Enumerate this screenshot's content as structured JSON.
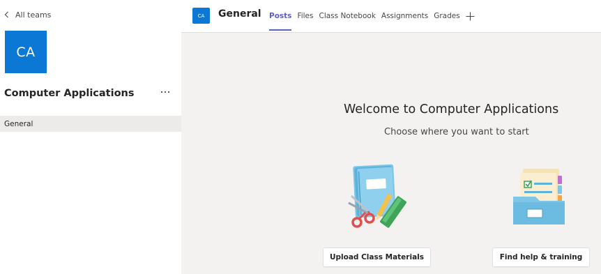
{
  "sidebar": {
    "back_label": "All teams",
    "team_avatar_initials": "CA",
    "team_name": "Computer Applications",
    "channels": [
      {
        "label": "General",
        "selected": true
      }
    ]
  },
  "header": {
    "channel_avatar_initials": "CA",
    "channel_name": "General",
    "tabs": [
      {
        "label": "Posts",
        "active": true
      },
      {
        "label": "Files",
        "active": false
      },
      {
        "label": "Class Notebook",
        "active": false
      },
      {
        "label": "Assignments",
        "active": false
      },
      {
        "label": "Grades",
        "active": false
      }
    ],
    "add_tab_icon": "plus-icon"
  },
  "welcome": {
    "title": "Welcome to Computer Applications",
    "subtitle": "Choose where you want to start",
    "actions": [
      {
        "label": "Upload Class Materials",
        "icon": "notebook-scissors-illustration"
      },
      {
        "label": "Find help & training",
        "icon": "folder-documents-illustration"
      }
    ]
  },
  "colors": {
    "brand": "#0a78d4",
    "accent": "#5b5fc7",
    "sidebar_selected": "#edebe9",
    "canvas": "#f3f2f1"
  }
}
